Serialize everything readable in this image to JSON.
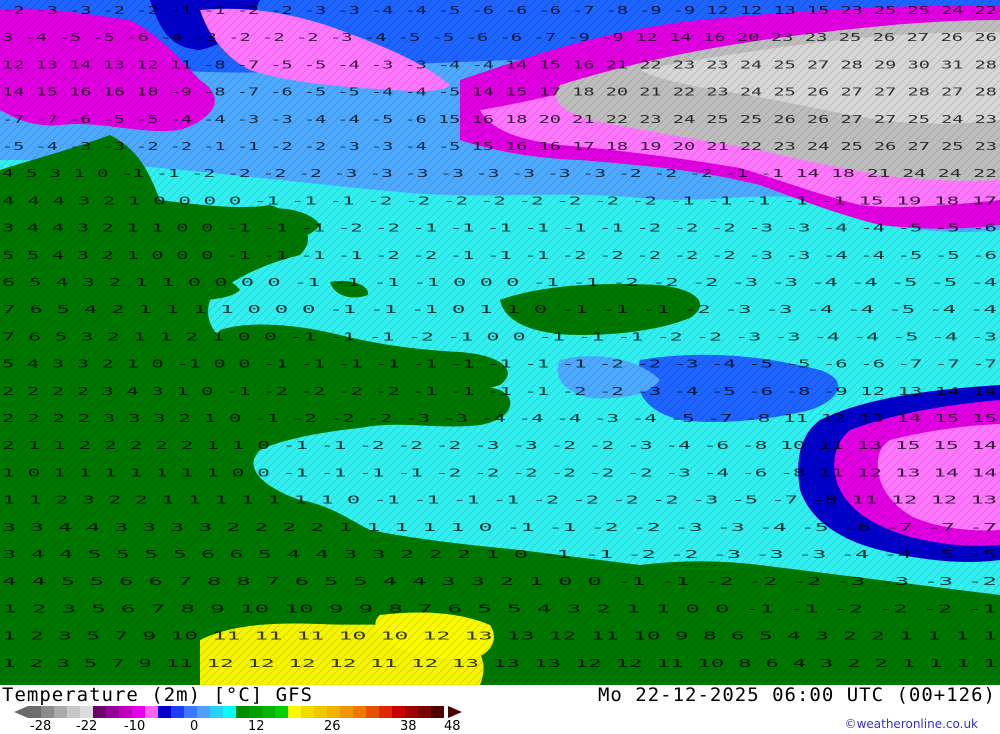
{
  "title_left": "Temperature (2m) [°C] GFS",
  "title_right": "Mo 22-12-2025 06:00 UTC (00+126)",
  "copyright": "©weatheronline.co.uk",
  "legend": {
    "ticks": [
      "-28",
      "-22",
      "-10",
      "0",
      "12",
      "26",
      "38",
      "48"
    ],
    "colors": [
      "#6e6e6e",
      "#8c8c8c",
      "#aaaaaa",
      "#c8c8c8",
      "#dcdcdc",
      "#6e006e",
      "#960096",
      "#be00be",
      "#e600e6",
      "#ff64ff",
      "#0000c8",
      "#1e3cff",
      "#3c78ff",
      "#50a0ff",
      "#28d2ff",
      "#00ffff",
      "#008c00",
      "#00a000",
      "#00b400",
      "#00d200",
      "#fafa00",
      "#f0dc00",
      "#f0c800",
      "#f0b400",
      "#f09600",
      "#f07800",
      "#e65000",
      "#dc2800",
      "#c80000",
      "#a00000",
      "#780000",
      "#500000"
    ]
  },
  "map": {
    "colors": {
      "cyan": "#32f0f0",
      "green": "#007800",
      "blue": "#1e64ff",
      "navy": "#0000c8",
      "light_blue": "#4eaaff",
      "magenta": "#e100e1",
      "pink": "#ff78ff",
      "gray": "#bebebe",
      "silver": "#d7d7d7",
      "yellow": "#f5f500"
    },
    "value_rows": [
      "-2 -3 -3 -2 -2 -1 -1 -2 -2 -3 -3 -4 -4 -5 -6 -6 -6 -7 -8 -9 -9 12 12 13 15 23 25 25 24 22",
      "3 -4 -5 -5 -6 -4 -3 -2 -2 -2 -3 -4 -5 -5 -6 -6 -7 -9 -9 12 14 16 20 23 23 25 26 27 26 26",
      "12 13 14 13 12 11 -8 -7 -5 -5 -4 -3 -3 -4 -4 14 15 16 21 22 23 23 24 25 27 28 29 30 31 28",
      "14 15 16 16 18 -9 -8 -7 -6 -5 -5 -4 -4 -5 14 15 17 18 20 21 22 23 24 25 26 27 27 28 27 28",
      "-7 -7 -6 -5 -5 -4 -4 -3 -3 -4 -4 -5 -6 15 16 18 20 21 22 23 24 25 25 26 26 27 27 25 24 23",
      "-5 -4 -3 -3 -2 -2 -1 -1 -2 -2 -3 -3 -4 -5 15 16 16 17 18 19 20 21 22 23 24 25 26 27 25 23",
      "4 5 3 1 0 -1 -1 -2 -2 -2 -2 -3 -3 -3 -3 -3 -3 -3 -3 -2 -2 -2 -1 -1 14 18 21 24 24 22",
      "4 4 4 3 2 1 0 0 0 0 -1 -1 -1 -2 -2 -2 -2 -2 -2 -2 -2 -1 -1 -1 -1 -1 15 19 18 17",
      "3 4 4 3 2 1 1 0 0 -1 -1 -1 -2 -2 -1 -1 -1 -1 -1 -1 -2 -2 -2 -3 -3 -4 -4 -5 -5 -6",
      "5 5 4 3 2 1 0 0 0 -1 -1 -1 -1 -2 -2 -1 -1 -1 -2 -2 -2 -2 -2 -3 -3 -4 -4 -5 -5 -6",
      "6 5 4 3 2 1 1 0 0 0 0 -1 -1 -1 -1 0 0 0 -1 -1 -2 -2 -2 -3 -3 -4 -4 -5 -5 -4",
      "7 6 5 4 2 1 1 1 1 0 0 0 -1 -1 -1 0 1 1 0 -1 -1 -1 -2 -3 -3 -4 -4 -5 -4 -4",
      "7 6 5 3 2 1 1 2 1 0 0 -1 -1 -1 -2 -1 0 0 -1 -1 -1 -2 -2 -3 -3 -4 -4 -5 -4 -3",
      "5 4 3 3 2 1 0 -1 0 0 -1 -1 -1 -1 -1 -1 -1 -1 -1 -2 -2 -3 -4 -5 -5 -6 -6 -7 -7 -7",
      "2 2 2 2 3 4 3 1 0 -1 -2 -2 -2 -2 -1 -1 -1 -1 -2 -2 -3 -4 -5 -6 -8 -9 12 13 14 14",
      "2 2 2 2 3 3 3 2 1 0 -1 -2 -2 -2 -3 -3 -4 -4 -4 -3 -4 -5 -7 -8 11 12 13 14 15 15",
      "2 1 1 2 2 2 2 2 1 1 0 -1 -1 -2 -2 -2 -3 -3 -2 -2 -3 -4 -6 -8 10 11 13 15 15 14",
      "1 0 1 1 1 1 1 1 1 0 0 -1 -1 -1 -1 -2 -2 -2 -2 -2 -2 -3 -4 -6 -8 11 12 13 14 14",
      "1 1 2 3 2 2 1 1 1 1 1 1 1 0 -1 -1 -1 -1 -2 -2 -2 -2 -3 -5 -7 -8 11 12 12 13",
      "3 3 4 4 3 3 3 3 2 2 2 2 1 1 1 1 1 0 -1 -1 -2 -2 -3 -3 -4 -5 -6 -7 -7 -7",
      "3 4 4 5 5 5 5 6 6 5 4 4 3 3 2 2 2 1 0 -1 -1 -2 -2 -3 -3 -3 -4 -4 -5 -5",
      "4 4 5 5 6 6 7 8 8 7 6 5 5 4 4 3 3 2 1 0 0 -1 -1 -2 -2 -2 -3 -3 -3 -2",
      "1 2 3 5 6 7 8 9 10 10 9 9 8 7 6 5 5 4 3 2 1 1 0 0 -1 -1 -2 -2 -2 -1",
      "1 2 3 5 7 9 10 11 11 11 10 10 12 13 13 12 11 10 9 8 6 5 4 3 2 2 1 1 1 1",
      "1 2 3 5 7 9 11 12 12 12 12 11 12 13 13 13 12 12 11 10 8 6 4 3 2 2 1 1 1 1"
    ]
  }
}
